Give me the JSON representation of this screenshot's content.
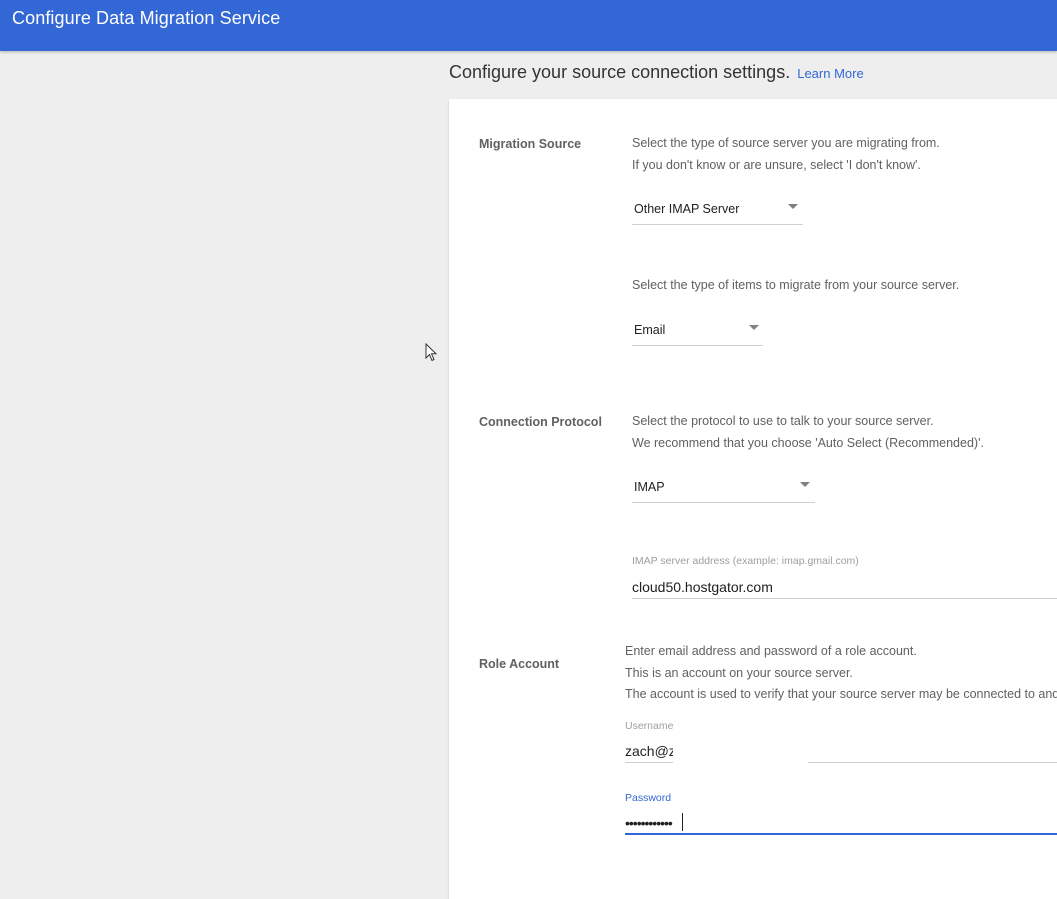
{
  "app": {
    "title": "Configure Data Migration Service"
  },
  "page": {
    "heading": "Configure your source connection settings.",
    "learn_more": "Learn More"
  },
  "migration_source": {
    "label": "Migration Source",
    "desc_line1": "Select the type of source server you are migrating from.",
    "desc_line2": "If you don't know or are unsure, select 'I don't know'.",
    "server_type": "Other IMAP Server",
    "items_desc": "Select the type of items to migrate from your source server.",
    "items_type": "Email"
  },
  "connection_protocol": {
    "label": "Connection Protocol",
    "desc_line1": "Select the protocol to use to talk to your source server.",
    "desc_line2": "We recommend that you choose 'Auto Select (Recommended)'.",
    "protocol": "IMAP",
    "server_address_label": "IMAP server address (example: imap.gmail.com)",
    "server_address_value": "cloud50.hostgator.com"
  },
  "role_account": {
    "label": "Role Account",
    "desc_line1": "Enter email address and password of a role account.",
    "desc_line2": "This is an account on your source server.",
    "desc_line3": "The account is used to verify that your source server may be connected to and",
    "username_label": "Username",
    "username_value": "zach@z",
    "password_label": "Password",
    "password_value": "••••••••••••"
  },
  "colors": {
    "brand": "#3367d6",
    "background": "#eeeeee",
    "card": "#ffffff",
    "label_text": "#616161"
  },
  "icons": {
    "dropdown": "caret-down-icon",
    "pointer": "mouse-pointer-icon"
  }
}
